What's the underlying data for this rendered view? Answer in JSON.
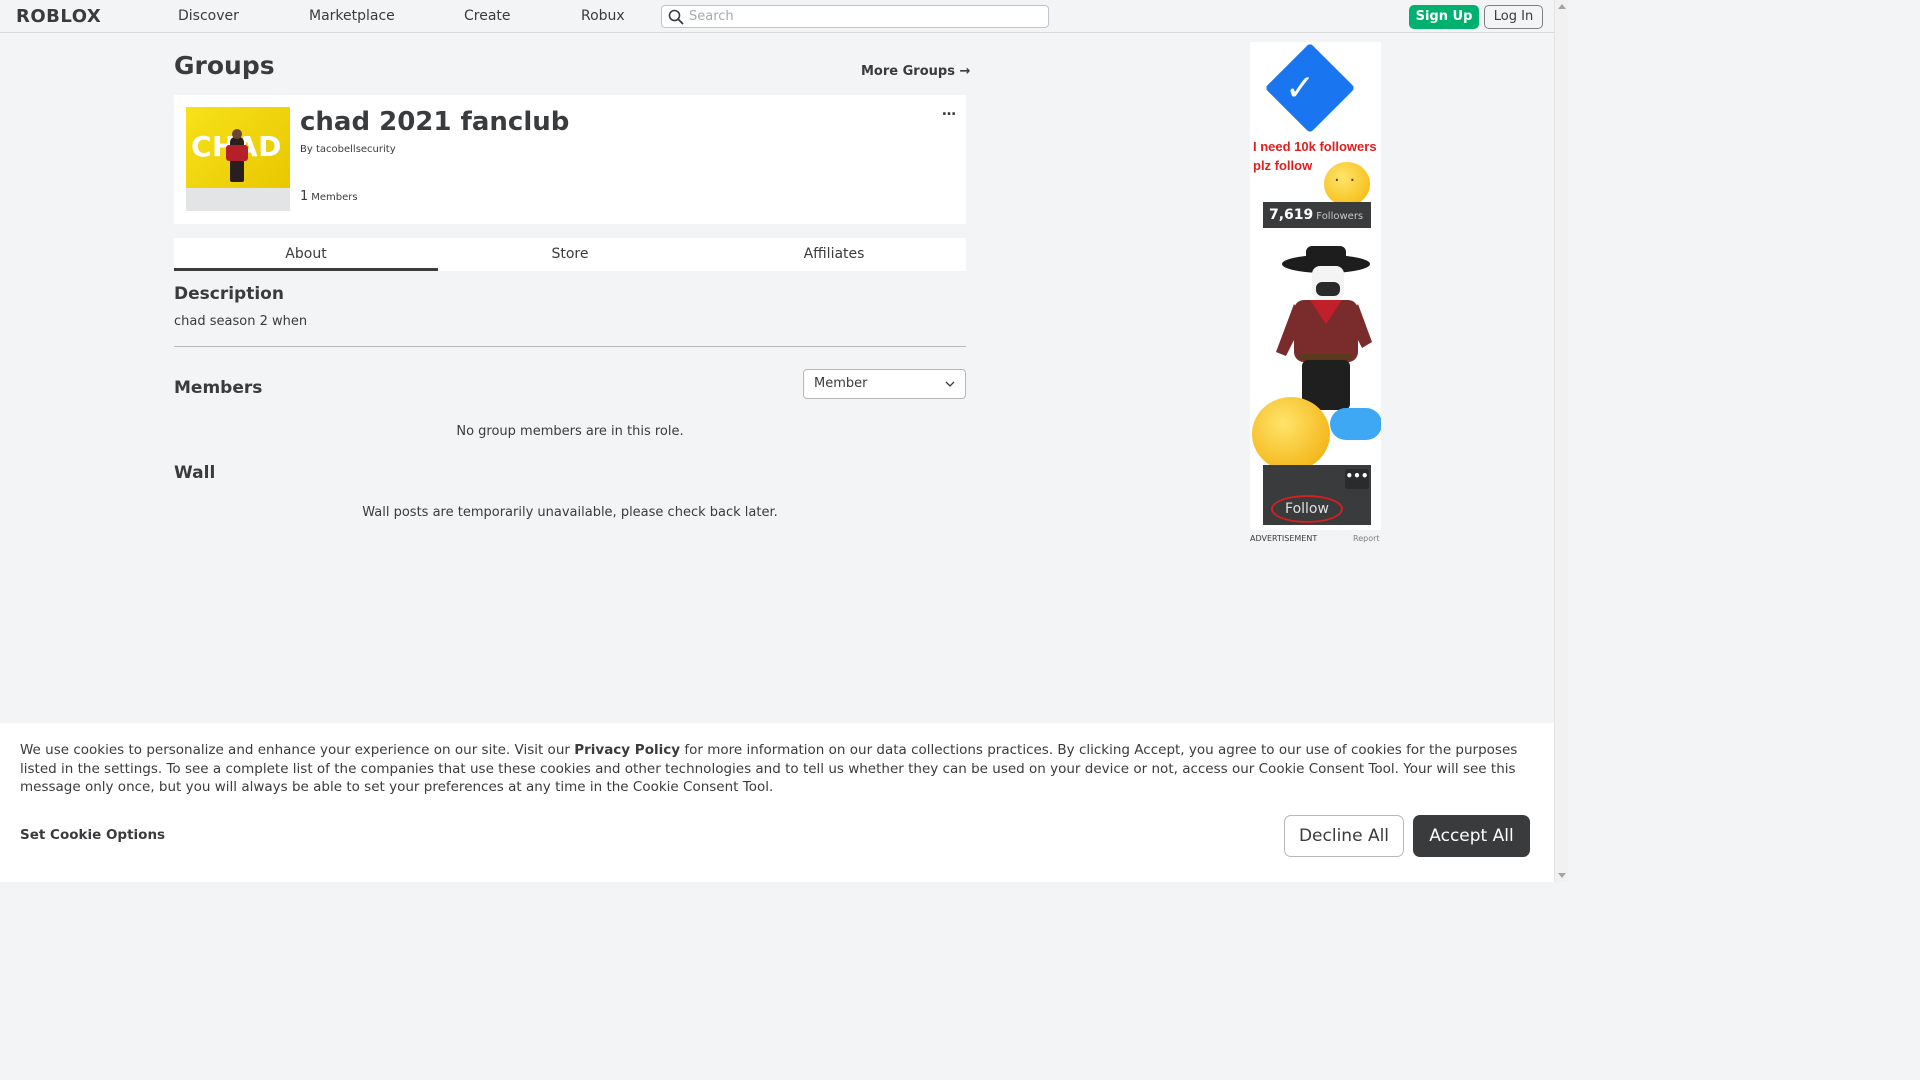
{
  "nav": {
    "logo": "ROBLOX",
    "links": [
      "Discover",
      "Marketplace",
      "Create",
      "Robux"
    ],
    "search_placeholder": "Search",
    "signup_label": "Sign Up",
    "login_label": "Log In"
  },
  "page": {
    "title": "Groups",
    "more_groups": "More Groups →"
  },
  "group": {
    "thumbnail_text": "CHAD",
    "name": "chad 2021 fanclub",
    "by_prefix": "By",
    "owner": "tacobellsecurity",
    "member_count": "1",
    "members_label": "Members",
    "menu_glyph": "…"
  },
  "tabs": [
    {
      "label": "About",
      "active": true
    },
    {
      "label": "Store",
      "active": false
    },
    {
      "label": "Affiliates",
      "active": false
    }
  ],
  "description": {
    "title": "Description",
    "text": "chad season 2 when"
  },
  "members": {
    "title": "Members",
    "role_selected": "Member",
    "empty_text": "No group members are in this role."
  },
  "wall": {
    "title": "Wall",
    "unavailable_text": "Wall posts are temporarily unavailable, please check back later."
  },
  "ad": {
    "headline": "I need 10k followers plz follow",
    "followers_count": "7,619",
    "followers_label": "Followers",
    "panel_dots": "•••",
    "follow_label": "Follow",
    "advertisement_label": "ADVERTISEMENT",
    "report_label": "Report"
  },
  "cookie": {
    "text_before": "We use cookies to personalize and enhance your experience on our site. Visit our ",
    "privacy_link": "Privacy Policy",
    "text_after": " for more information on our data collections practices. By clicking Accept, you agree to our use of cookies for the purposes listed in the settings. To see a complete list of the companies that use these cookies and other technologies and to tell us whether they can be used on your device or not, access our Cookie Consent Tool. Your will see this message only once, but you will always be able to set your preferences at any time in the Cookie Consent Tool.",
    "set_options": "Set Cookie Options",
    "decline_label": "Decline All",
    "accept_label": "Accept All"
  },
  "colors": {
    "signup_green": "#00b06f",
    "page_bg": "#f2f4f5",
    "text_dark": "#393b3d",
    "ad_red": "#e01e1e",
    "ad_blue": "#1976f0"
  }
}
